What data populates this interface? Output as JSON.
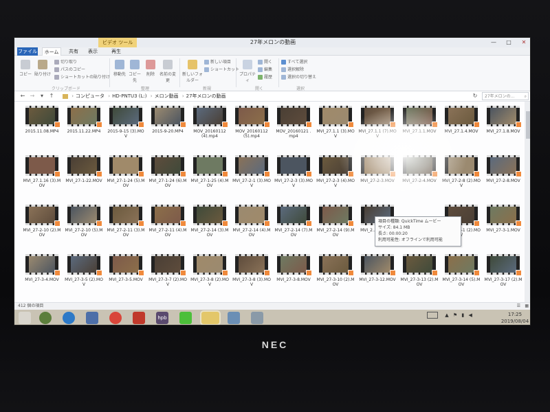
{
  "device": {
    "brand": "NEC"
  },
  "window": {
    "context_tab": "ビデオ ツール",
    "title": "27年メロンの動画",
    "controls": [
      "—",
      "□",
      "✕"
    ]
  },
  "tabs": [
    {
      "label": "ファイル"
    },
    {
      "label": "ホーム"
    },
    {
      "label": "共有"
    },
    {
      "label": "表示"
    },
    {
      "label": "再生"
    }
  ],
  "ribbon": {
    "clipboard": {
      "copy": "コピー",
      "paste": "貼り付け",
      "cut": "切り取り",
      "copy_path": "パスのコピー",
      "paste_shortcut": "ショートカットの貼り付け",
      "group": "クリップボード"
    },
    "organize": {
      "move_to": "移動先",
      "copy_to": "コピー先",
      "delete": "削除",
      "rename": "名前の変更",
      "group": "整理"
    },
    "new": {
      "new_folder": "新しいフォルダー",
      "new_item": "新しい項目",
      "shortcut": "ショートカット",
      "group": "新規"
    },
    "open": {
      "properties": "プロパティ",
      "open": "開く",
      "edit": "編集",
      "history": "履歴",
      "group": "開く"
    },
    "select": {
      "select_all": "すべて選択",
      "select_none": "選択解除",
      "invert": "選択の切り替え",
      "group": "選択"
    }
  },
  "address": {
    "crumbs": [
      "コンピュータ",
      "HD-PNTU3 (L:)",
      "メロン動画",
      "27年メロンの動画"
    ],
    "search_placeholder": "27年メロンの..."
  },
  "files": [
    [
      "2015.11.08.MP4",
      "2015.11.22.MP4",
      "2015-9-15 (3).MOV",
      "2015-9-20.MP4",
      "MOV_20160112 (4).mp4",
      "MOV_20160112 (5).mp4",
      "MOV_20160121 .mp4",
      "MVI_27.1.1 (3).MOV",
      "MVI_27.1.1 (7).MOV",
      "MVI_27.1.1.MOV",
      "MVI_27.1.4.MOV",
      "MVI_27.1.8.MOV"
    ],
    [
      "MVI_27.1.16 (3).MOV",
      "MVI_27-1-22.MOV",
      "MVI_27-1-24 (5).MOV",
      "MVI_27-1-24 (6).MOV",
      "MVI_27-1-25 (4).MOV",
      "MVI_27-2-1 (3).MOV",
      "MVI_27-2-3 (3).MOV",
      "MVI_27-2-3 (4).MOV",
      "MVI_27-2-3.MOV",
      "MVI_27-2-4.MOV",
      "MVI_27-2-8 (2).MOV",
      "MVI_27-2-8.MOV"
    ],
    [
      "MVI_27-2-10 (2).MOV",
      "MVI_27-2-10 (5).MOV",
      "MVI_27-2-11 (3).MOV",
      "MVI_27-2-11 (4).MOV",
      "MVI_27-2-14 (3).MOV",
      "MVI_27-2-14 (4).MOV",
      "MVI_27-2-14 (7).MOV",
      "MVI_27-2-14 (9).MOV",
      "MVI_2... (3).MOV",
      "",
      "MVI_27-3-1 (2).MOV",
      "MVI_27-3-1.MOV"
    ],
    [
      "MVI_27-3-4.MOV",
      "MVI_27-3-5 (2).MOV",
      "MVI_27-3-5.MOV",
      "MVI_27-3-7 (2).MOV",
      "MVI_27-3-8 (2).MOV",
      "MVI_27-3-8 (3).MOV",
      "MVI_27-3-8.MOV",
      "MVI_27-3-10 (2).MOV",
      "MVI_27-3-12.MOV",
      "MVI_27-3-13 (2).MOV",
      "MVI_27-3-14 (5).MOV",
      "MVI_27-3-17 (2).MOV"
    ]
  ],
  "tooltip": {
    "line1": "項目の種類: QuickTime ムービー",
    "line2": "サイズ: 84.1 MB",
    "line3": "長さ: 00:00:20",
    "line4": "利用可能性: オフラインで利用可能"
  },
  "status": {
    "count": "412 個の項目"
  },
  "taskbar": {
    "hpb": "hpb"
  },
  "clock": {
    "time": "17:25",
    "date": "2019/08/04"
  },
  "colors": {
    "file_tab": "#2a66b8",
    "taskbar": "#c9c3b4",
    "play_badge": "#f08a3c"
  }
}
